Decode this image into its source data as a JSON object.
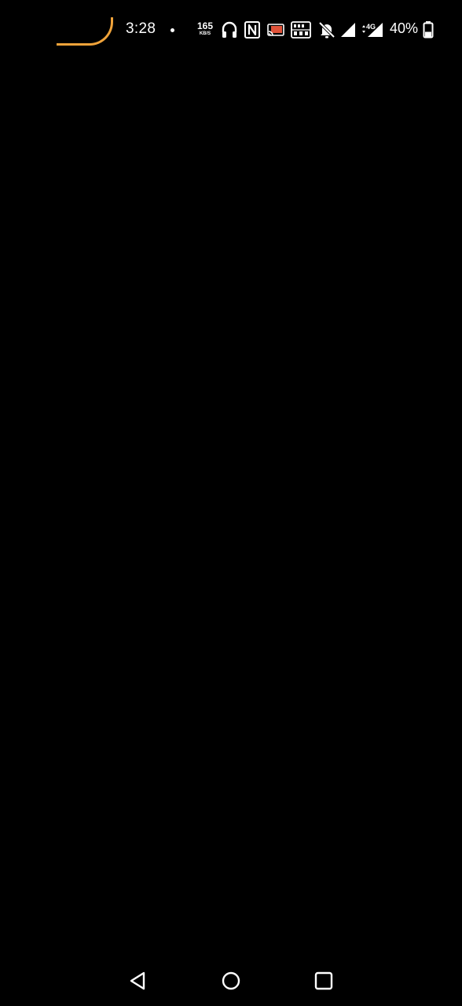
{
  "status_bar": {
    "time": "3:28",
    "network_speed_value": "165",
    "network_speed_unit": "KB/S",
    "volte_badge": "VoLTE",
    "mobile_data_label": "4G",
    "battery_percent": "40%",
    "battery_level": 0.4,
    "icons": [
      "notification-dot-icon",
      "headphones-icon",
      "nfc-icon",
      "cast-icon",
      "volte-icon",
      "notifications-muted-icon",
      "wifi-signal-icon",
      "mobile-signal-icon",
      "battery-icon"
    ]
  },
  "colors": {
    "background": "#000000",
    "foreground": "#ffffff",
    "camera_accent": "#f0a33a",
    "cast_accent": "#e0533a"
  },
  "nav_bar": {
    "buttons": [
      "back-icon",
      "home-icon",
      "recents-icon"
    ]
  }
}
